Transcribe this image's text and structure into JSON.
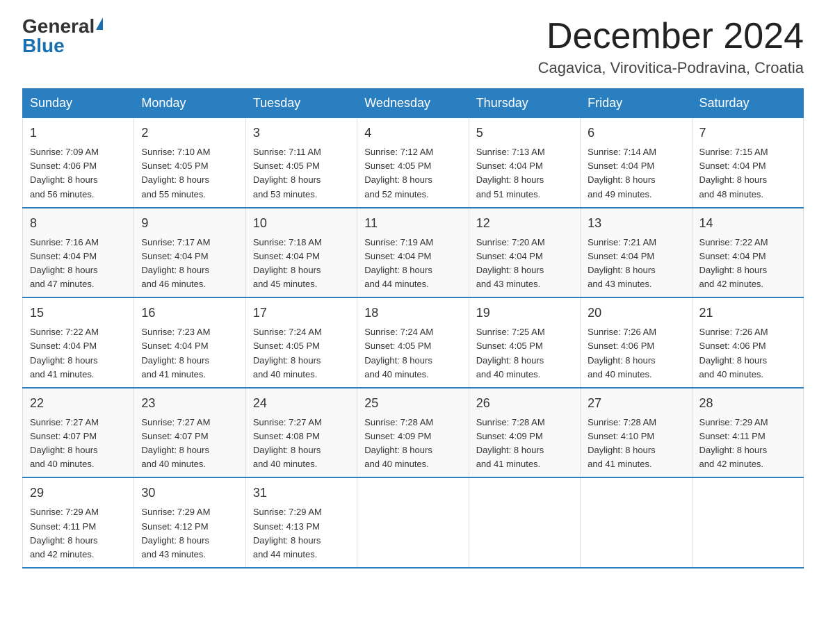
{
  "logo": {
    "general": "General",
    "blue": "Blue"
  },
  "header": {
    "month": "December 2024",
    "location": "Cagavica, Virovitica-Podravina, Croatia"
  },
  "days_of_week": [
    "Sunday",
    "Monday",
    "Tuesday",
    "Wednesday",
    "Thursday",
    "Friday",
    "Saturday"
  ],
  "weeks": [
    [
      {
        "day": "1",
        "sunrise": "7:09 AM",
        "sunset": "4:06 PM",
        "daylight": "8 hours and 56 minutes."
      },
      {
        "day": "2",
        "sunrise": "7:10 AM",
        "sunset": "4:05 PM",
        "daylight": "8 hours and 55 minutes."
      },
      {
        "day": "3",
        "sunrise": "7:11 AM",
        "sunset": "4:05 PM",
        "daylight": "8 hours and 53 minutes."
      },
      {
        "day": "4",
        "sunrise": "7:12 AM",
        "sunset": "4:05 PM",
        "daylight": "8 hours and 52 minutes."
      },
      {
        "day": "5",
        "sunrise": "7:13 AM",
        "sunset": "4:04 PM",
        "daylight": "8 hours and 51 minutes."
      },
      {
        "day": "6",
        "sunrise": "7:14 AM",
        "sunset": "4:04 PM",
        "daylight": "8 hours and 49 minutes."
      },
      {
        "day": "7",
        "sunrise": "7:15 AM",
        "sunset": "4:04 PM",
        "daylight": "8 hours and 48 minutes."
      }
    ],
    [
      {
        "day": "8",
        "sunrise": "7:16 AM",
        "sunset": "4:04 PM",
        "daylight": "8 hours and 47 minutes."
      },
      {
        "day": "9",
        "sunrise": "7:17 AM",
        "sunset": "4:04 PM",
        "daylight": "8 hours and 46 minutes."
      },
      {
        "day": "10",
        "sunrise": "7:18 AM",
        "sunset": "4:04 PM",
        "daylight": "8 hours and 45 minutes."
      },
      {
        "day": "11",
        "sunrise": "7:19 AM",
        "sunset": "4:04 PM",
        "daylight": "8 hours and 44 minutes."
      },
      {
        "day": "12",
        "sunrise": "7:20 AM",
        "sunset": "4:04 PM",
        "daylight": "8 hours and 43 minutes."
      },
      {
        "day": "13",
        "sunrise": "7:21 AM",
        "sunset": "4:04 PM",
        "daylight": "8 hours and 43 minutes."
      },
      {
        "day": "14",
        "sunrise": "7:22 AM",
        "sunset": "4:04 PM",
        "daylight": "8 hours and 42 minutes."
      }
    ],
    [
      {
        "day": "15",
        "sunrise": "7:22 AM",
        "sunset": "4:04 PM",
        "daylight": "8 hours and 41 minutes."
      },
      {
        "day": "16",
        "sunrise": "7:23 AM",
        "sunset": "4:04 PM",
        "daylight": "8 hours and 41 minutes."
      },
      {
        "day": "17",
        "sunrise": "7:24 AM",
        "sunset": "4:05 PM",
        "daylight": "8 hours and 40 minutes."
      },
      {
        "day": "18",
        "sunrise": "7:24 AM",
        "sunset": "4:05 PM",
        "daylight": "8 hours and 40 minutes."
      },
      {
        "day": "19",
        "sunrise": "7:25 AM",
        "sunset": "4:05 PM",
        "daylight": "8 hours and 40 minutes."
      },
      {
        "day": "20",
        "sunrise": "7:26 AM",
        "sunset": "4:06 PM",
        "daylight": "8 hours and 40 minutes."
      },
      {
        "day": "21",
        "sunrise": "7:26 AM",
        "sunset": "4:06 PM",
        "daylight": "8 hours and 40 minutes."
      }
    ],
    [
      {
        "day": "22",
        "sunrise": "7:27 AM",
        "sunset": "4:07 PM",
        "daylight": "8 hours and 40 minutes."
      },
      {
        "day": "23",
        "sunrise": "7:27 AM",
        "sunset": "4:07 PM",
        "daylight": "8 hours and 40 minutes."
      },
      {
        "day": "24",
        "sunrise": "7:27 AM",
        "sunset": "4:08 PM",
        "daylight": "8 hours and 40 minutes."
      },
      {
        "day": "25",
        "sunrise": "7:28 AM",
        "sunset": "4:09 PM",
        "daylight": "8 hours and 40 minutes."
      },
      {
        "day": "26",
        "sunrise": "7:28 AM",
        "sunset": "4:09 PM",
        "daylight": "8 hours and 41 minutes."
      },
      {
        "day": "27",
        "sunrise": "7:28 AM",
        "sunset": "4:10 PM",
        "daylight": "8 hours and 41 minutes."
      },
      {
        "day": "28",
        "sunrise": "7:29 AM",
        "sunset": "4:11 PM",
        "daylight": "8 hours and 42 minutes."
      }
    ],
    [
      {
        "day": "29",
        "sunrise": "7:29 AM",
        "sunset": "4:11 PM",
        "daylight": "8 hours and 42 minutes."
      },
      {
        "day": "30",
        "sunrise": "7:29 AM",
        "sunset": "4:12 PM",
        "daylight": "8 hours and 43 minutes."
      },
      {
        "day": "31",
        "sunrise": "7:29 AM",
        "sunset": "4:13 PM",
        "daylight": "8 hours and 44 minutes."
      },
      null,
      null,
      null,
      null
    ]
  ],
  "labels": {
    "sunrise": "Sunrise:",
    "sunset": "Sunset:",
    "daylight": "Daylight:"
  }
}
